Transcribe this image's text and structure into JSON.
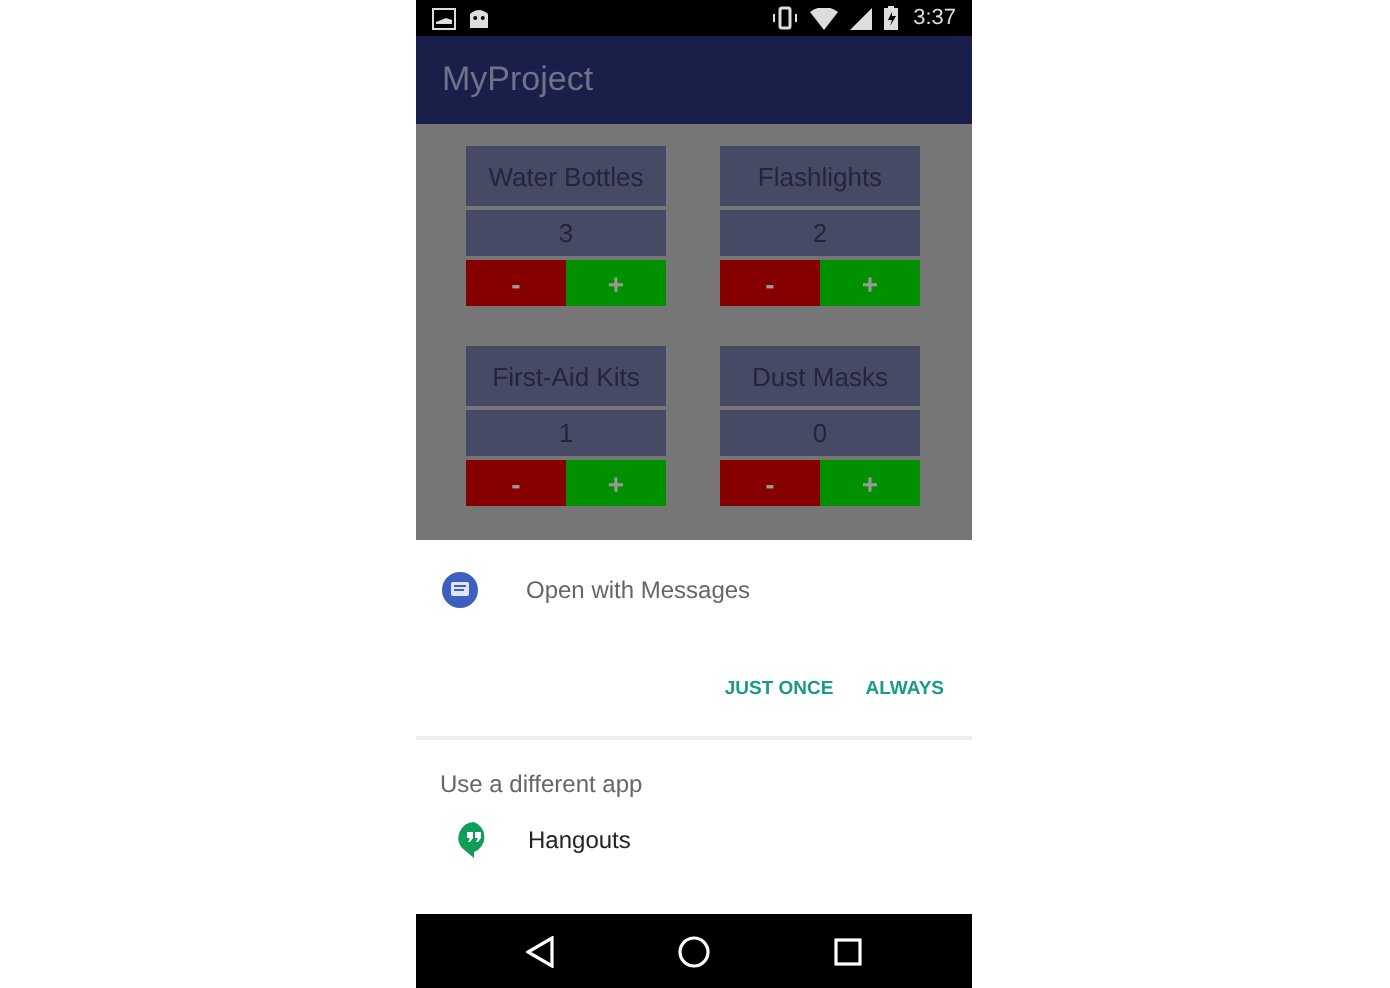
{
  "status_bar": {
    "time": "3:37"
  },
  "app_bar": {
    "title": "MyProject"
  },
  "items": [
    {
      "name": "Water Bottles",
      "count": "3",
      "minus": "-",
      "plus": "+"
    },
    {
      "name": "Flashlights",
      "count": "2",
      "minus": "-",
      "plus": "+"
    },
    {
      "name": "First-Aid Kits",
      "count": "1",
      "minus": "-",
      "plus": "+"
    },
    {
      "name": "Dust Masks",
      "count": "0",
      "minus": "-",
      "plus": "+"
    }
  ],
  "chooser": {
    "open_with": "Open with Messages",
    "buttons": [
      "JUST ONCE",
      "ALWAYS"
    ],
    "other_heading": "Use a different app",
    "apps": [
      {
        "label": "Hangouts"
      }
    ]
  }
}
